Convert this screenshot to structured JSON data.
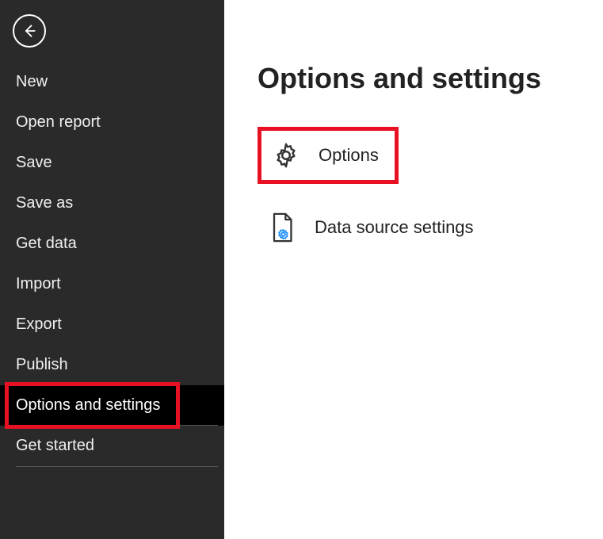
{
  "sidebar": {
    "items": [
      {
        "label": "New"
      },
      {
        "label": "Open report"
      },
      {
        "label": "Save"
      },
      {
        "label": "Save as"
      },
      {
        "label": "Get data"
      },
      {
        "label": "Import"
      },
      {
        "label": "Export"
      },
      {
        "label": "Publish"
      },
      {
        "label": "Options and settings"
      },
      {
        "label": "Get started"
      }
    ]
  },
  "content": {
    "title": "Options and settings",
    "options": [
      {
        "label": "Options"
      },
      {
        "label": "Data source settings"
      }
    ]
  }
}
